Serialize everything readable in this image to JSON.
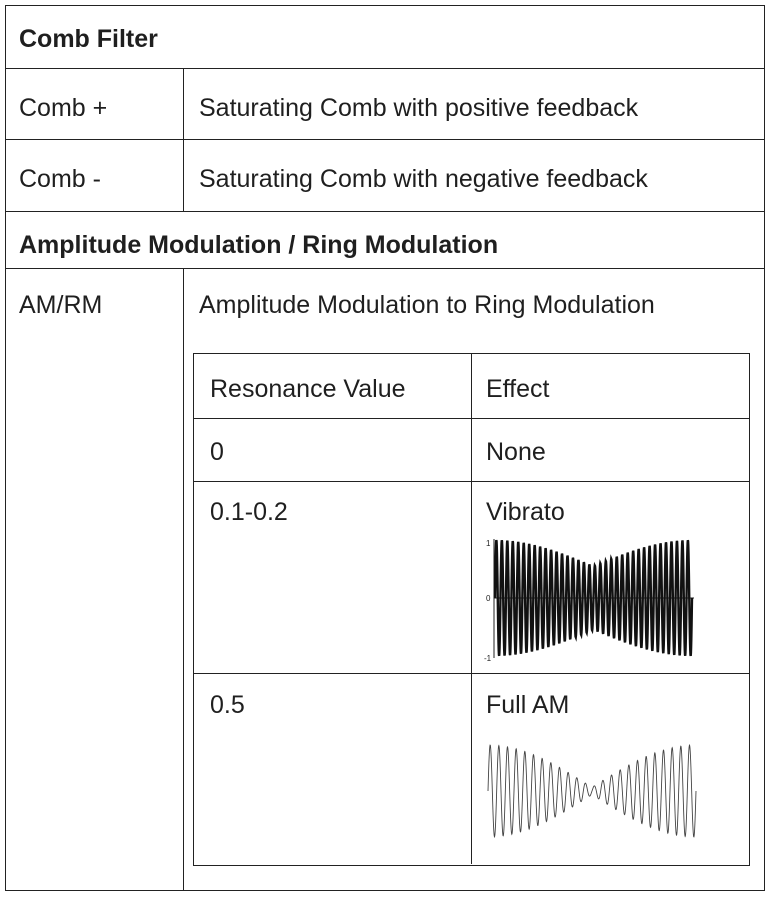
{
  "sections": {
    "comb_filter": {
      "heading": "Comb Filter",
      "rows": [
        {
          "name": "Comb +",
          "description": "Saturating Comb with positive feedback"
        },
        {
          "name": "Comb -",
          "description": "Saturating Comb with negative feedback"
        }
      ]
    },
    "am_rm": {
      "heading": "Amplitude Modulation / Ring Modulation",
      "row_name": "AM/RM",
      "row_description": "Amplitude Modulation to Ring Modulation",
      "subtable": {
        "headers": [
          "Resonance Value",
          "Effect"
        ],
        "rows": [
          {
            "value": "0",
            "effect": "None"
          },
          {
            "value": "0.1-0.2",
            "effect": "Vibrato"
          },
          {
            "value": "0.5",
            "effect": "Full AM"
          }
        ],
        "vibrato_plot_ticks": [
          "1",
          "0",
          "-1"
        ]
      }
    }
  }
}
